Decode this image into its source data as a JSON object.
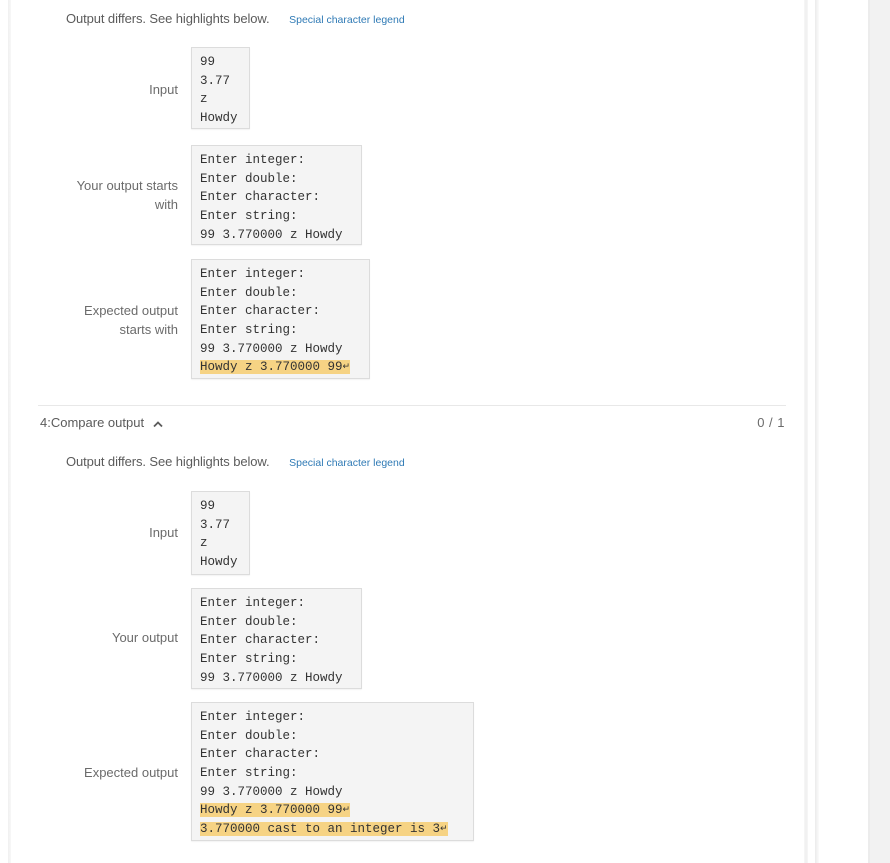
{
  "tests": [
    {
      "status_message": "Output differs. See highlights below.",
      "legend_link": "Special character legend",
      "rows": [
        {
          "label_lines": [
            "Input"
          ],
          "lines": [
            {
              "text": "99",
              "highlight": false,
              "ret": false
            },
            {
              "text": "3.77",
              "highlight": false,
              "ret": false
            },
            {
              "text": "z",
              "highlight": false,
              "ret": false
            },
            {
              "text": "Howdy",
              "highlight": false,
              "ret": false
            }
          ]
        },
        {
          "label_lines": [
            "Your output starts",
            "with"
          ],
          "lines": [
            {
              "text": "Enter integer:",
              "highlight": false,
              "ret": false
            },
            {
              "text": "Enter double:",
              "highlight": false,
              "ret": false
            },
            {
              "text": "Enter character:",
              "highlight": false,
              "ret": false
            },
            {
              "text": "Enter string:",
              "highlight": false,
              "ret": false
            },
            {
              "text": "99 3.770000 z Howdy",
              "highlight": false,
              "ret": false
            }
          ]
        },
        {
          "label_lines": [
            "Expected output",
            "starts with"
          ],
          "lines": [
            {
              "text": "Enter integer:",
              "highlight": false,
              "ret": false
            },
            {
              "text": "Enter double:",
              "highlight": false,
              "ret": false
            },
            {
              "text": "Enter character:",
              "highlight": false,
              "ret": false
            },
            {
              "text": "Enter string:",
              "highlight": false,
              "ret": false
            },
            {
              "text": "99 3.770000 z Howdy",
              "highlight": false,
              "ret": false
            },
            {
              "text": "Howdy z 3.770000 99",
              "highlight": true,
              "ret": true
            }
          ]
        }
      ]
    },
    {
      "header": {
        "title": "4:Compare output",
        "icon": "chevron-up-icon",
        "score": "0 / 1"
      },
      "status_message": "Output differs. See highlights below.",
      "legend_link": "Special character legend",
      "rows": [
        {
          "label_lines": [
            "Input"
          ],
          "lines": [
            {
              "text": "99",
              "highlight": false,
              "ret": false
            },
            {
              "text": "3.77",
              "highlight": false,
              "ret": false
            },
            {
              "text": "z",
              "highlight": false,
              "ret": false
            },
            {
              "text": "Howdy",
              "highlight": false,
              "ret": false
            }
          ]
        },
        {
          "label_lines": [
            "Your output"
          ],
          "lines": [
            {
              "text": "Enter integer:",
              "highlight": false,
              "ret": false
            },
            {
              "text": "Enter double:",
              "highlight": false,
              "ret": false
            },
            {
              "text": "Enter character:",
              "highlight": false,
              "ret": false
            },
            {
              "text": "Enter string:",
              "highlight": false,
              "ret": false
            },
            {
              "text": "99 3.770000 z Howdy",
              "highlight": false,
              "ret": false
            }
          ]
        },
        {
          "label_lines": [
            "Expected output"
          ],
          "lines": [
            {
              "text": "Enter integer:",
              "highlight": false,
              "ret": false
            },
            {
              "text": "Enter double:",
              "highlight": false,
              "ret": false
            },
            {
              "text": "Enter character:",
              "highlight": false,
              "ret": false
            },
            {
              "text": "Enter string:",
              "highlight": false,
              "ret": false
            },
            {
              "text": "99 3.770000 z Howdy",
              "highlight": false,
              "ret": false
            },
            {
              "text": "Howdy z 3.770000 99",
              "highlight": true,
              "ret": true
            },
            {
              "text": "3.770000 cast to an integer is 3",
              "highlight": true,
              "ret": true
            }
          ]
        }
      ]
    }
  ],
  "return_glyph": "↵",
  "colors": {
    "highlight": "#f6d384",
    "link": "#2f7ab5",
    "code_bg": "#f4f4f4"
  }
}
